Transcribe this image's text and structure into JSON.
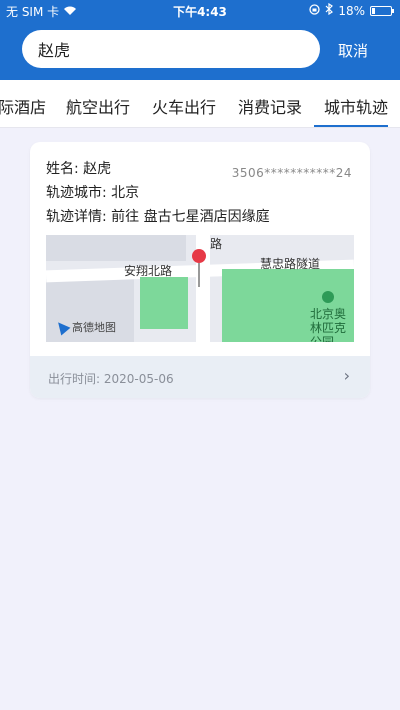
{
  "status_bar": {
    "carrier": "无 SIM 卡",
    "time": "下午4:43",
    "battery": "18%",
    "battery_level": 0.18
  },
  "search": {
    "value": "赵虎"
  },
  "cancel_label": "取消",
  "tabs": [
    {
      "label": "际酒店"
    },
    {
      "label": "航空出行"
    },
    {
      "label": "火车出行"
    },
    {
      "label": "消费记录"
    },
    {
      "label": "城市轨迹"
    }
  ],
  "active_tab": 4,
  "record": {
    "name_label": "姓名:",
    "name": "赵虎",
    "id_number": "3506***********24",
    "city_label": "轨迹城市:",
    "city": "北京",
    "detail_label": "轨迹详情:",
    "detail": "前往 盘古七星酒店因缘庭",
    "map": {
      "road_1": "安翔北路",
      "road_2": "慧忠路隧道",
      "road_3": "路",
      "park": "北京奥林匹克公园",
      "logo": "高德地图"
    },
    "footer_label": "出行时间:",
    "date": "2020-05-06"
  },
  "colors": {
    "header": "#1e6fce",
    "background": "#f1f1fb",
    "park_green": "#7dd89a",
    "pin": "#e63946"
  }
}
